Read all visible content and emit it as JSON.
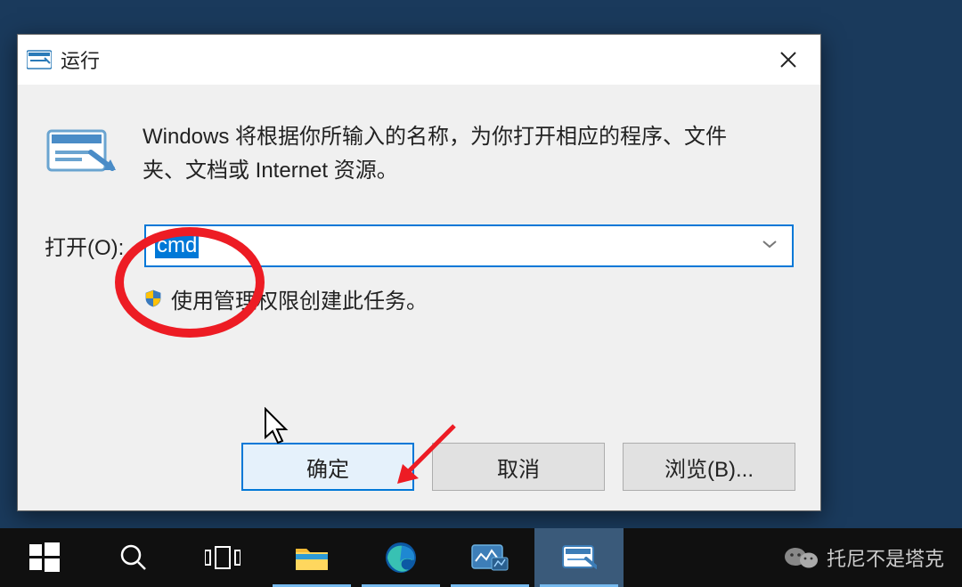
{
  "dialog": {
    "title": "运行",
    "description": "Windows 将根据你所输入的名称，为你打开相应的程序、文件夹、文档或 Internet 资源。",
    "open_label": "打开(O):",
    "open_value": "cmd",
    "admin_text": "使用管理权限创建此任务。",
    "buttons": {
      "ok": "确定",
      "cancel": "取消",
      "browse": "浏览(B)..."
    }
  },
  "watermark": "托尼不是塔克"
}
